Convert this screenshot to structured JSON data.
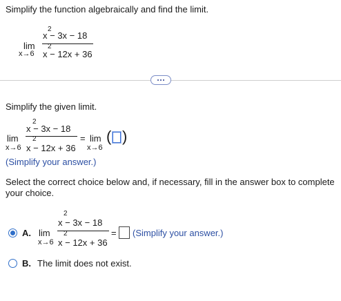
{
  "question": {
    "prompt": "Simplify the function algebraically and find the limit.",
    "limit": {
      "lim": "lim",
      "approach": "x→6",
      "numerator": "x  − 3x − 18",
      "numerator_power": "2",
      "denominator": "x  − 12x + 36",
      "denominator_power": "2"
    }
  },
  "more_button": {
    "label": "more"
  },
  "simplify_step": {
    "heading": "Simplify the given limit.",
    "lim": "lim",
    "approach": "x→6",
    "numerator": "x  − 3x − 18",
    "numerator_power": "2",
    "denominator": "x  − 12x + 36",
    "denominator_power": "2",
    "equals": "=",
    "rhs_lim": "lim",
    "rhs_approach": "x→6",
    "hint": "(Simplify your answer.)",
    "answer_value": ""
  },
  "choice_section": {
    "instruction_line1": "Select the correct choice below and, if necessary, fill in the answer box to complete",
    "instruction_line2": "your choice.",
    "choices": [
      {
        "letter": "A.",
        "selected": true,
        "lim": "lim",
        "approach": "x→6",
        "numerator": "x  − 3x − 18",
        "numerator_power": "2",
        "denominator": "x  − 12x + 36",
        "denominator_power": "2",
        "equals": "=",
        "hint": "(Simplify your answer.)",
        "answer_value": ""
      },
      {
        "letter": "B.",
        "selected": false,
        "text": "The limit does not exist."
      }
    ]
  },
  "colors": {
    "accent": "#2f6fc9",
    "hint": "#2c4fa3",
    "separator": "#cfcfcf"
  }
}
